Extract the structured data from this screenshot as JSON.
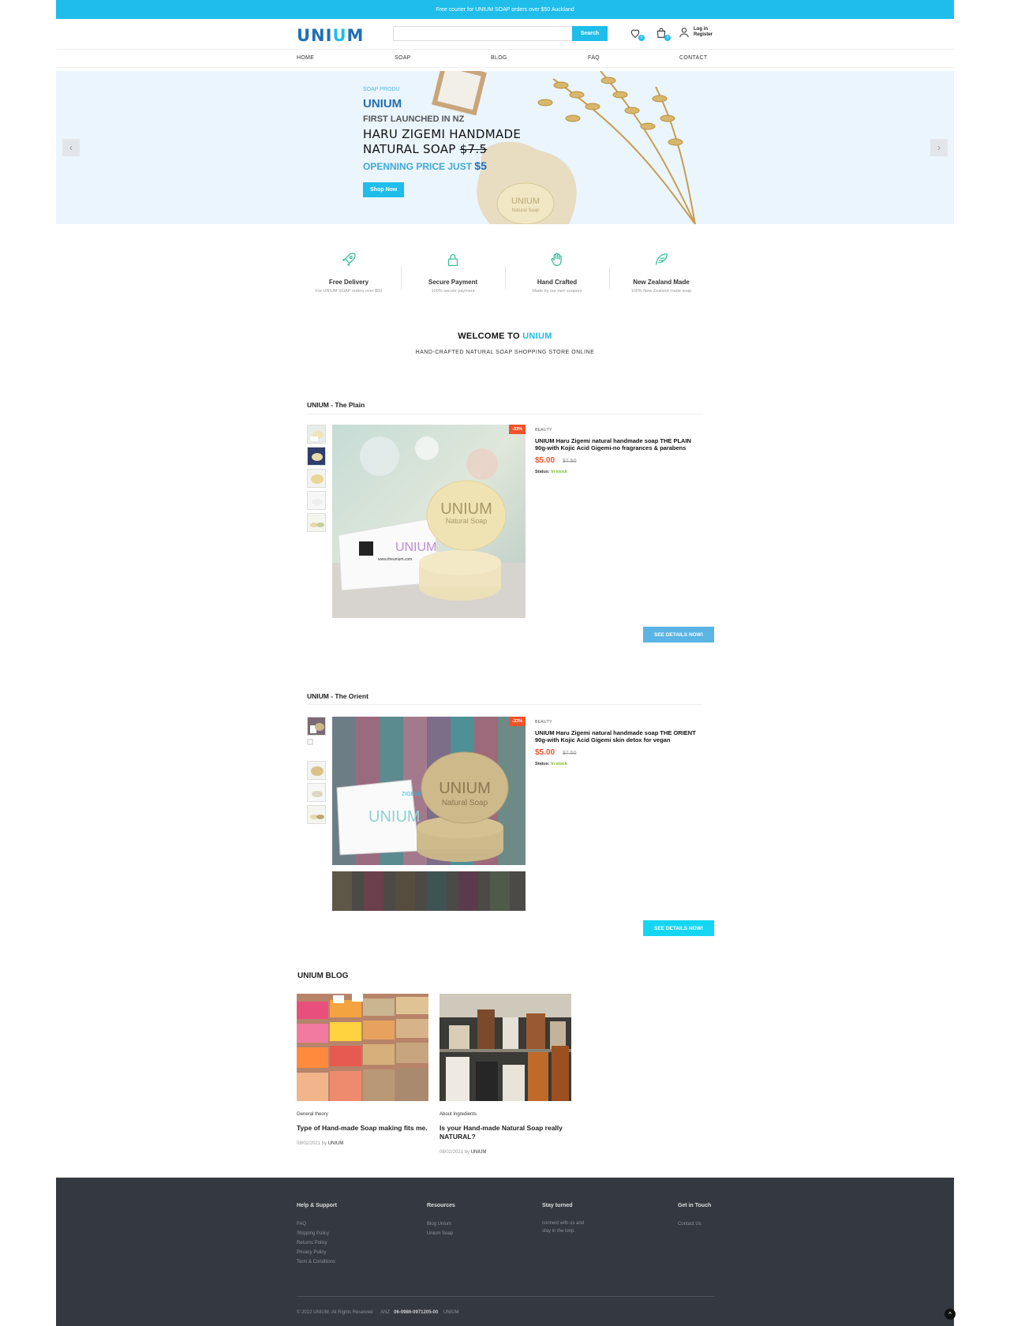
{
  "topbar": {
    "text": "Free courier for UNIUM SOAP orders over $50 Auckland"
  },
  "header": {
    "logo_part1": "UNI",
    "logo_part2": "U",
    "logo_part3": "M",
    "search_placeholder": "",
    "search_button": "Search",
    "wishlist_count": "0",
    "cart_count": "0",
    "login": "Log in",
    "register": "Register"
  },
  "nav": [
    "HOME",
    "SOAP",
    "BLOG",
    "FAQ",
    "CONTACT"
  ],
  "hero": {
    "kicker": "SOAP PRODU",
    "brand": "UNIUM",
    "subtitle": "FIRST LAUNCHED IN NZ",
    "title_line1": "HARU ZIGEMI HANDMADE",
    "title_line2": "NATURAL SOAP",
    "old_price": "$7.5",
    "price_label": "OPENNING PRICE JUST",
    "price": "$5",
    "button": "Shop Now",
    "product_stamp": "UNIUM",
    "product_stamp_sub": "Natural Soap"
  },
  "features": [
    {
      "icon": "rocket-icon",
      "title": "Free Delivery",
      "sub": "For UNIUM SOAP orders over $50"
    },
    {
      "icon": "lock-icon",
      "title": "Secure Payment",
      "sub": "100% secure payment"
    },
    {
      "icon": "hand-icon",
      "title": "Hand Crafted",
      "sub": "Made by our own soapers"
    },
    {
      "icon": "feather-icon",
      "title": "New Zealand Made",
      "sub": "100% New Zealand made soap"
    }
  ],
  "welcome": {
    "prefix": "WELCOME TO",
    "brand": "UNIUM",
    "sub": "HAND-CRAFTED NATURAL SOAP SHOPPING STORE ONLINE"
  },
  "products": [
    {
      "section_title": "UNIUM - The Plain",
      "discount": "-33%",
      "category": "BEAUTY",
      "name": "UNIUM Haru Zigemi natural handmade soap THE PLAIN 90g-with Kojic Acid Gigemi-no fragrances & parabens",
      "price": "$5.00",
      "old_price": "$7.50",
      "status_label": "Status:",
      "status": "In stock",
      "button": "SEE DETAILS NOW!",
      "stamp": "UNIUM",
      "stamp_sub": "Natural Soap",
      "box_text": "UNIUM",
      "box_url": "www.theunium.com"
    },
    {
      "section_title": "UNIUM - The Orient",
      "discount": "-33%",
      "category": "BEAUTY",
      "name": "UNIUM Haru Zigemi natural handmade soap THE ORIENT 90g-with Kojic Acid Gigemi skin detox for vegan",
      "price": "$5.00",
      "old_price": "$7.50",
      "status_label": "Status:",
      "status": "In stock",
      "button": "SEE DETAILS NOW!",
      "stamp": "UNIUM",
      "stamp_sub": "Natural Soap",
      "box_text": "UNIUM",
      "box_brand": "ZIGEMI"
    }
  ],
  "blog": {
    "heading": "UNIUM BLOG",
    "posts": [
      {
        "category": "General theory",
        "title": "Type of Hand-made Soap making fits me.",
        "date": "08/02/2021 by",
        "author": "UNIUM"
      },
      {
        "category": "About Ingredients",
        "title": "Is your Hand-made Natural Soap really NATURAL?",
        "date": "08/02/2021 by",
        "author": "UNIUM"
      }
    ]
  },
  "footer": {
    "help": {
      "title": "Help & Support",
      "links": [
        "FAQ",
        "Shipping Policy",
        "Returns Policy",
        "Privacy Policy",
        "Term & Conditions"
      ]
    },
    "resources": {
      "title": "Resources",
      "links": [
        "Blog Unium",
        "Unium Soap"
      ]
    },
    "stay": {
      "title": "Stay turned",
      "text_line1": "connect with us and",
      "text_line2": "stay in the loop."
    },
    "touch": {
      "title": "Get in Touch",
      "links": [
        "Contact Us"
      ]
    },
    "copyright": "© 2022 UNIUM. All Rights Reserved",
    "bank_label": "ANZ",
    "bank_number": "06-0986-0971205-00",
    "bank_name": "UNIUM"
  },
  "colors": {
    "accent": "#1fbdea",
    "brand": "#1f6fb5",
    "sale": "#f0532b",
    "stock": "#7cb926",
    "footer": "#343941"
  }
}
